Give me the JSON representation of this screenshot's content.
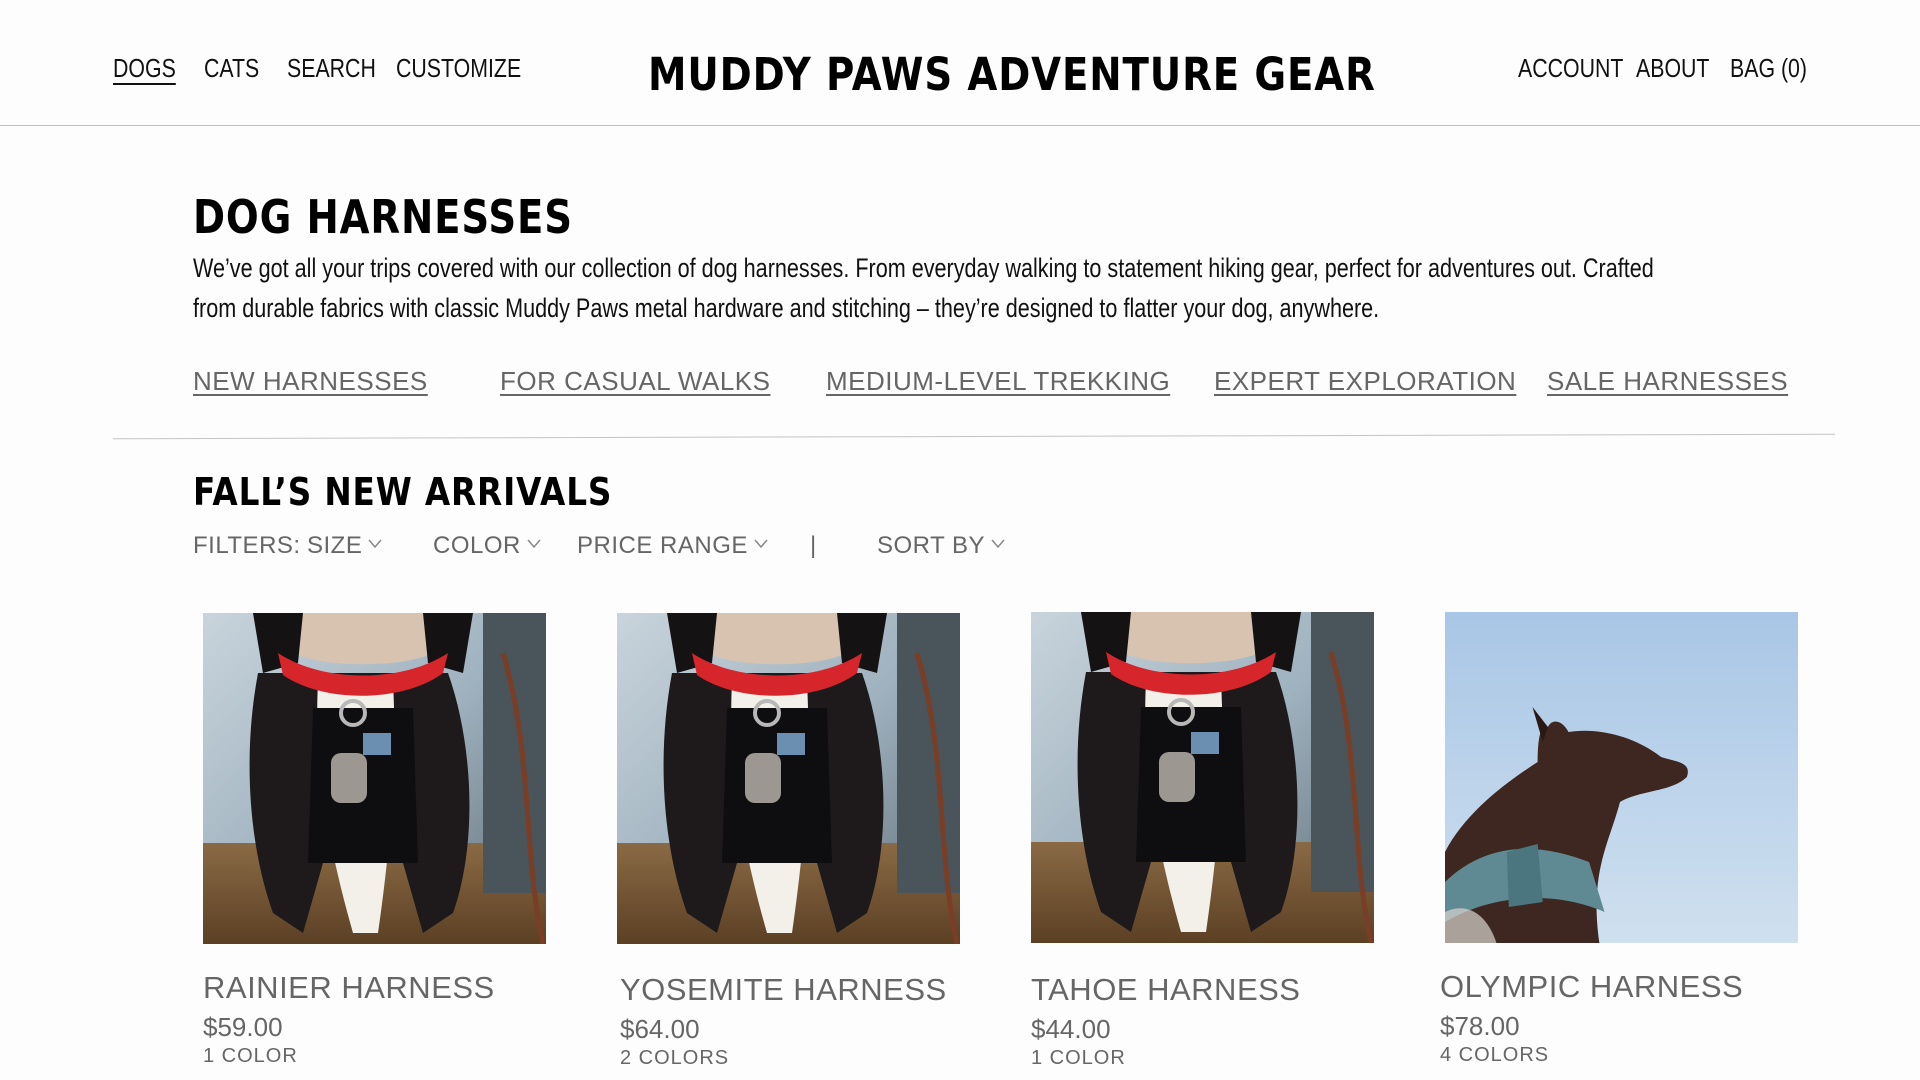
{
  "header": {
    "nav_left": [
      "DOGS",
      "CATS",
      "SEARCH",
      "CUSTOMIZE"
    ],
    "brand": "MUDDY PAWS ADVENTURE GEAR",
    "nav_right": [
      "ACCOUNT",
      "ABOUT",
      "BAG (0)"
    ]
  },
  "intro": {
    "title": "DOG HARNESSES",
    "description": "We’ve got all your trips covered with our collection of dog harnesses. From everyday walking to statement hiking gear, perfect for adventures out. Crafted from durable fabrics with classic Muddy Paws metal hardware and stitching – they’re designed to flatter your dog, anywhere."
  },
  "categories": [
    "NEW HARNESSES",
    "FOR CASUAL WALKS",
    "MEDIUM-LEVEL TREKKING",
    "EXPERT EXPLORATION",
    "SALE HARNESSES"
  ],
  "arrivals": {
    "title": "FALL’S NEW ARRIVALS",
    "filters_label": "FILTERS:",
    "filters": [
      "SIZE",
      "COLOR",
      "PRICE RANGE"
    ],
    "separator": "|",
    "sort_label": "SORT BY"
  },
  "products": [
    {
      "name": "RAINIER HARNESS",
      "price": "$59.00",
      "colors": "1 COLOR",
      "image": "dog-red-collar-photo"
    },
    {
      "name": "YOSEMITE HARNESS",
      "price": "$64.00",
      "colors": "2 COLORS",
      "image": "dog-red-collar-photo"
    },
    {
      "name": "TAHOE HARNESS",
      "price": "$44.00",
      "colors": "1 COLOR",
      "image": "dog-red-collar-photo"
    },
    {
      "name": "OLYMPIC HARNESS",
      "price": "$78.00",
      "colors": "4 COLORS",
      "image": "brown-dog-blue-harness-photo"
    }
  ],
  "theme": {
    "link_gray": "#666666",
    "rule": "#c4c4c4",
    "collar_red": "#d6262c"
  }
}
